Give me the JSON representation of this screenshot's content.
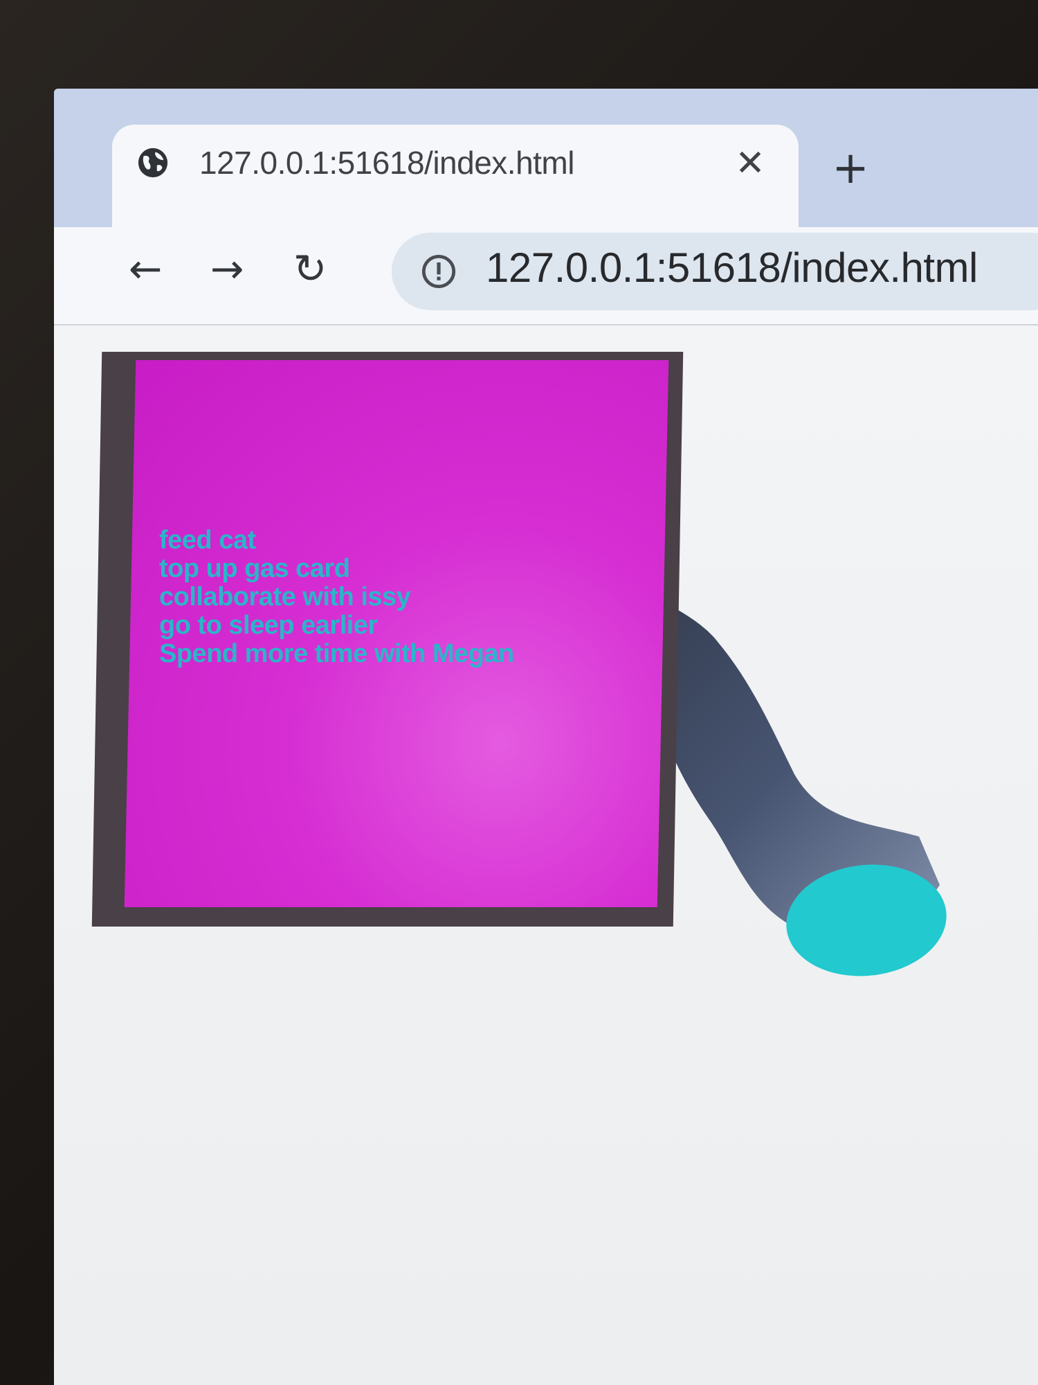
{
  "browser": {
    "tab": {
      "title": "127.0.0.1:51618/index.html",
      "favicon": "globe-icon",
      "close_glyph": "✕",
      "new_tab_glyph": "+"
    },
    "nav": {
      "back_glyph": "←",
      "forward_glyph": "→",
      "reload_glyph": "↻"
    },
    "address_bar": {
      "url": "127.0.0.1:51618/index.html",
      "security_icon": "info-icon"
    }
  },
  "page": {
    "sticky_note": {
      "color": "#d62ed3",
      "text_color": "#2bb5c9",
      "items": [
        "feed cat",
        "top up gas card",
        "collaborate with issy",
        "go to sleep earlier",
        "Spend more time with Megan"
      ]
    },
    "tube_shape": {
      "body_color": "#4a5a78",
      "cap_color": "#22c9cf"
    }
  }
}
